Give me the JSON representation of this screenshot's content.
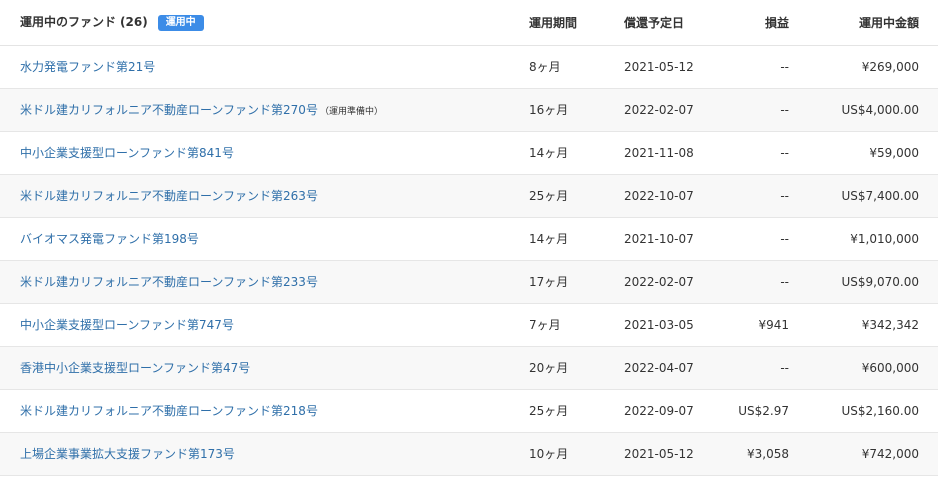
{
  "header": {
    "title": "運用中のファンド",
    "count": "(26)",
    "badge": "運用中",
    "columns": {
      "period": "運用期間",
      "repayment_date": "償還予定日",
      "profit_loss": "損益",
      "amount": "運用中金額"
    }
  },
  "funds": [
    {
      "name": "水力発電ファンド第21号",
      "note": "",
      "period": "8ヶ月",
      "date": "2021-05-12",
      "pl": "--",
      "amount": "¥269,000"
    },
    {
      "name": "米ドル建カリフォルニア不動産ローンファンド第270号",
      "note": "（運用準備中）",
      "period": "16ヶ月",
      "date": "2022-02-07",
      "pl": "--",
      "amount": "US$4,000.00"
    },
    {
      "name": "中小企業支援型ローンファンド第841号",
      "note": "",
      "period": "14ヶ月",
      "date": "2021-11-08",
      "pl": "--",
      "amount": "¥59,000"
    },
    {
      "name": "米ドル建カリフォルニア不動産ローンファンド第263号",
      "note": "",
      "period": "25ヶ月",
      "date": "2022-10-07",
      "pl": "--",
      "amount": "US$7,400.00"
    },
    {
      "name": "バイオマス発電ファンド第198号",
      "note": "",
      "period": "14ヶ月",
      "date": "2021-10-07",
      "pl": "--",
      "amount": "¥1,010,000"
    },
    {
      "name": "米ドル建カリフォルニア不動産ローンファンド第233号",
      "note": "",
      "period": "17ヶ月",
      "date": "2022-02-07",
      "pl": "--",
      "amount": "US$9,070.00"
    },
    {
      "name": "中小企業支援型ローンファンド第747号",
      "note": "",
      "period": "7ヶ月",
      "date": "2021-03-05",
      "pl": "¥941",
      "amount": "¥342,342"
    },
    {
      "name": "香港中小企業支援型ローンファンド第47号",
      "note": "",
      "period": "20ヶ月",
      "date": "2022-04-07",
      "pl": "--",
      "amount": "¥600,000"
    },
    {
      "name": "米ドル建カリフォルニア不動産ローンファンド第218号",
      "note": "",
      "period": "25ヶ月",
      "date": "2022-09-07",
      "pl": "US$2.97",
      "amount": "US$2,160.00"
    },
    {
      "name": "上場企業事業拡大支援ファンド第173号",
      "note": "",
      "period": "10ヶ月",
      "date": "2021-05-12",
      "pl": "¥3,058",
      "amount": "¥742,000"
    }
  ]
}
